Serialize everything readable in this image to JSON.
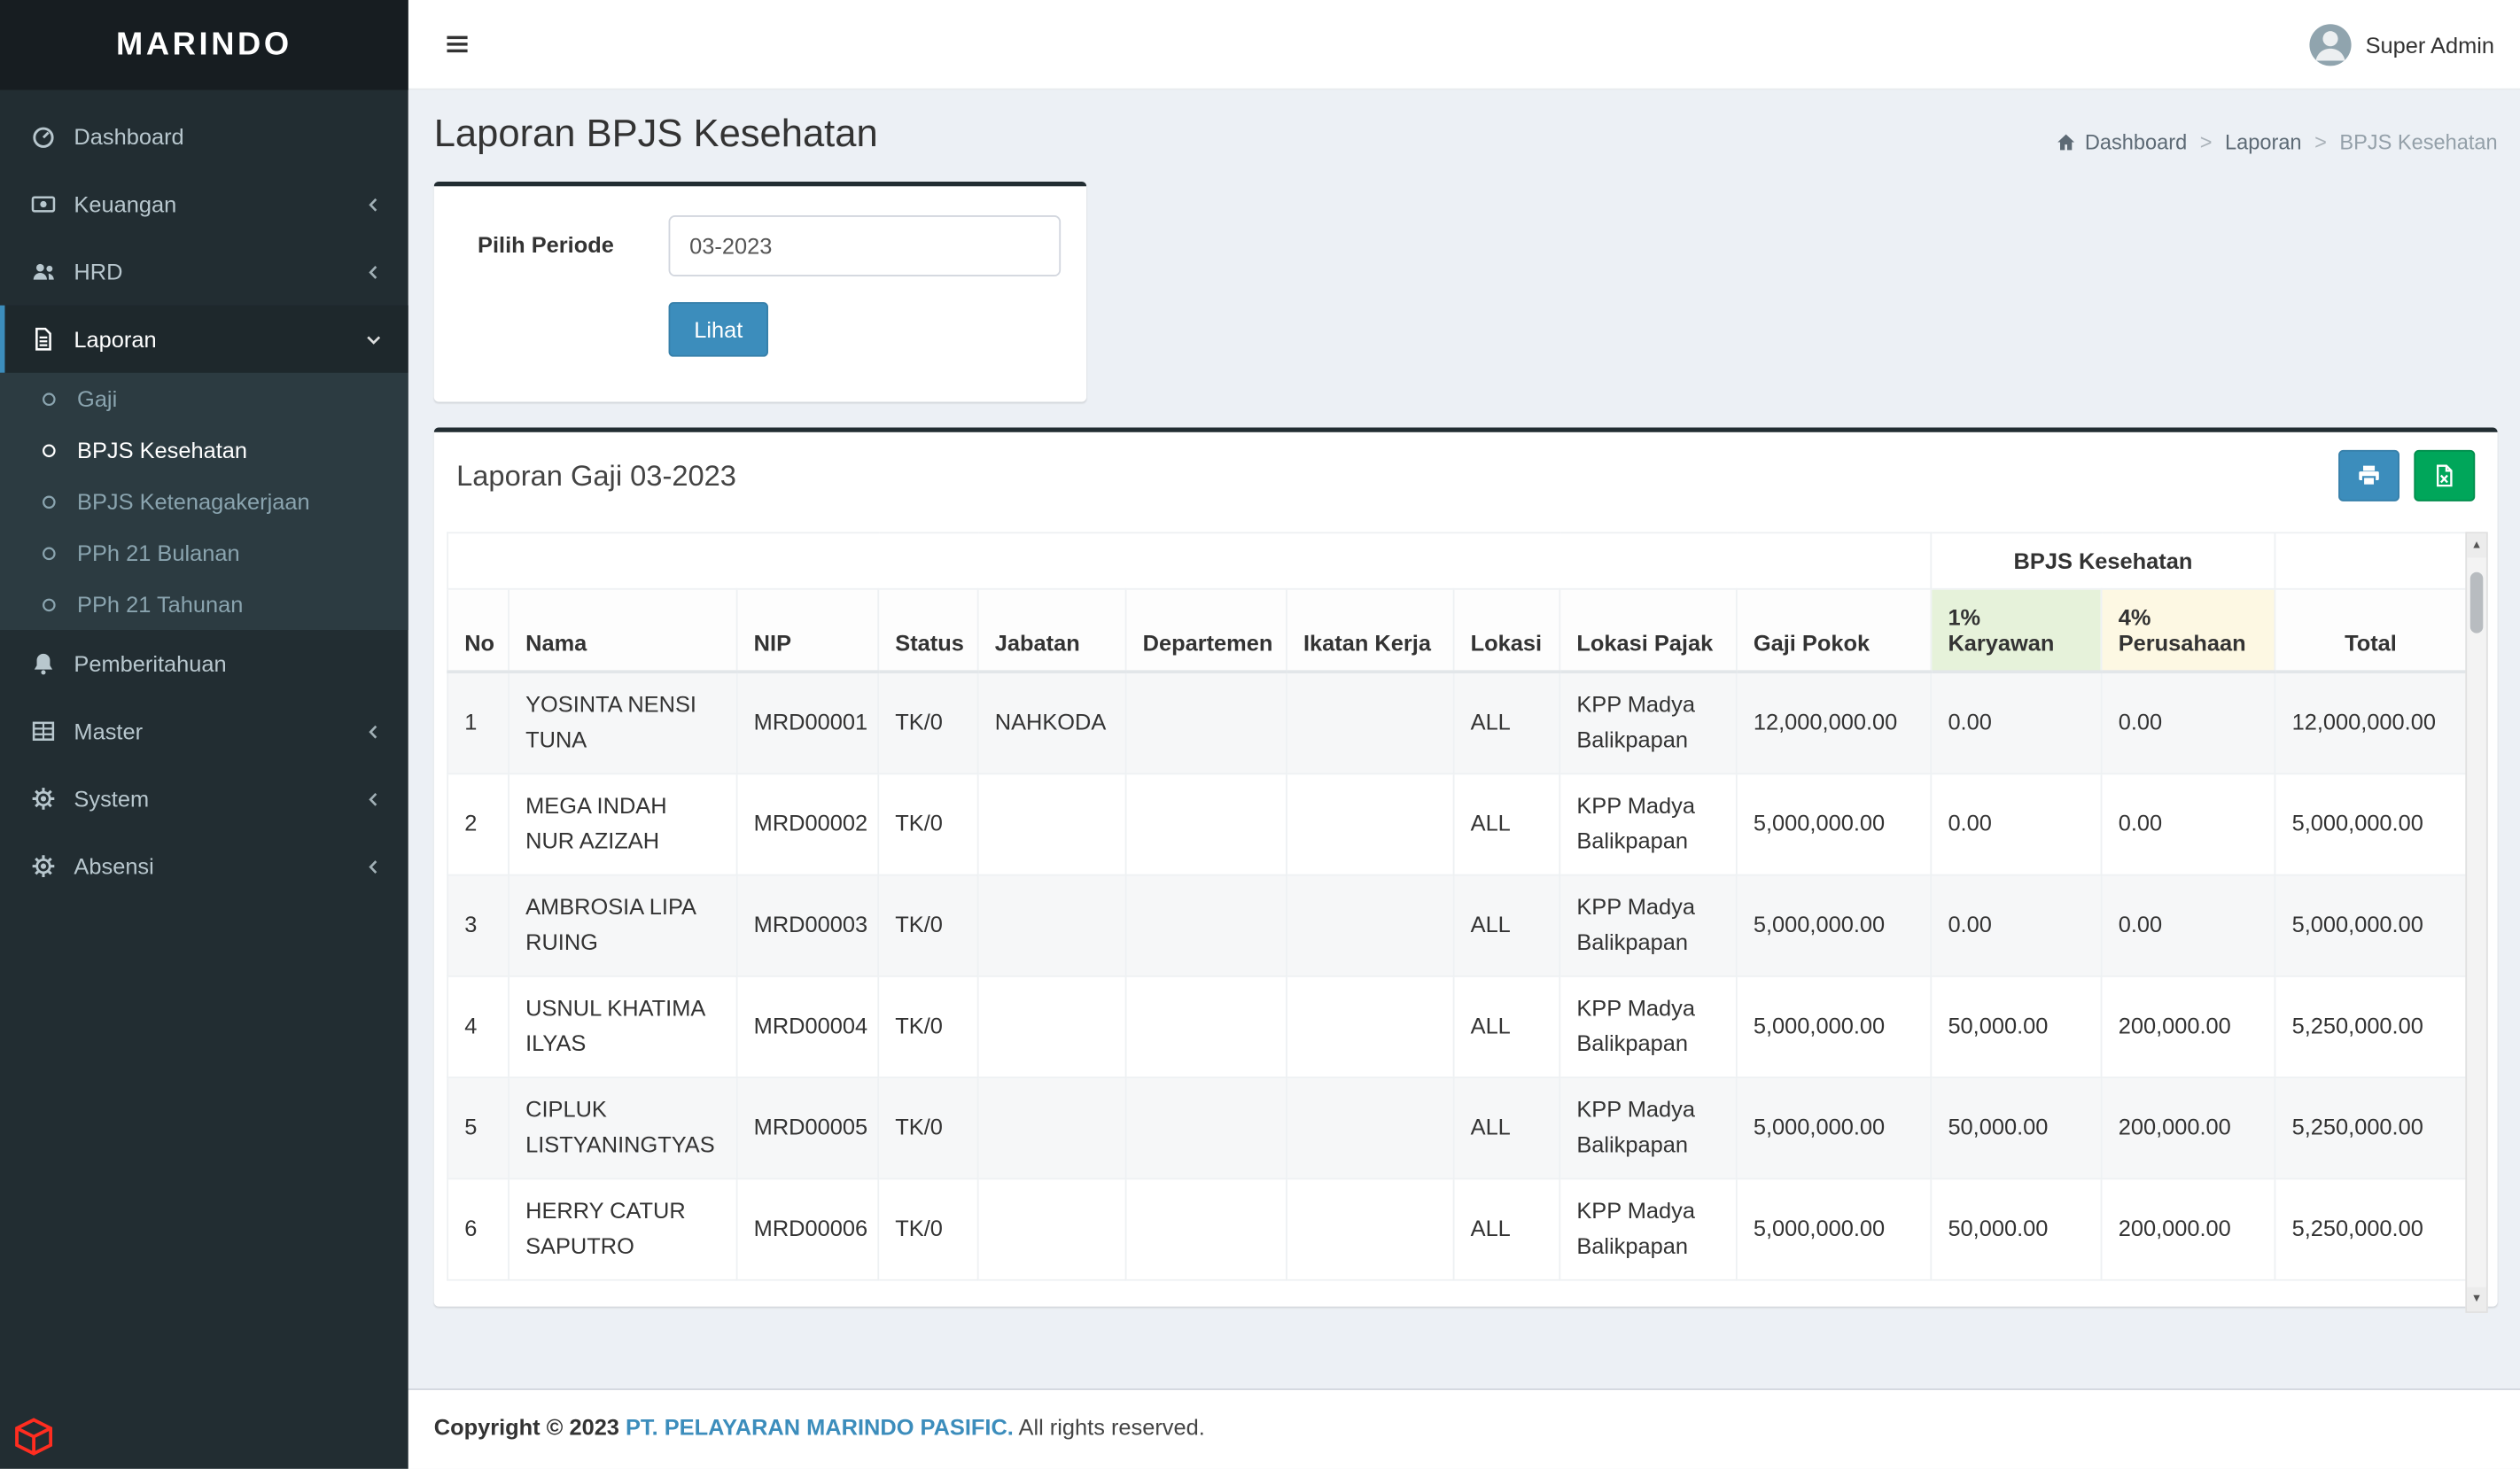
{
  "brand": "MARINDO",
  "topbar": {
    "user_name": "Super Admin"
  },
  "sidebar": {
    "items": [
      {
        "label": "Dashboard",
        "icon": "tachometer-icon"
      },
      {
        "label": "Keuangan",
        "icon": "money-icon",
        "chevron": "left"
      },
      {
        "label": "HRD",
        "icon": "users-icon",
        "chevron": "left"
      },
      {
        "label": "Laporan",
        "icon": "file-text-icon",
        "chevron": "down",
        "active": true
      },
      {
        "label": "Pemberitahuan",
        "icon": "bell-icon"
      },
      {
        "label": "Master",
        "icon": "table-icon",
        "chevron": "left"
      },
      {
        "label": "System",
        "icon": "gear-icon",
        "chevron": "left"
      },
      {
        "label": "Absensi",
        "icon": "gear-icon",
        "chevron": "left"
      }
    ],
    "laporan_children": [
      {
        "label": "Gaji",
        "icon": "circle-o-icon"
      },
      {
        "label": "BPJS Kesehatan",
        "icon": "circle-o-icon",
        "active": true
      },
      {
        "label": "BPJS Ketenagakerjaan",
        "icon": "circle-o-icon"
      },
      {
        "label": "PPh 21 Bulanan",
        "icon": "circle-o-icon"
      },
      {
        "label": "PPh 21 Tahunan",
        "icon": "circle-o-icon"
      }
    ]
  },
  "page": {
    "title": "Laporan BPJS Kesehatan",
    "breadcrumb": {
      "home": "Dashboard",
      "section": "Laporan",
      "current": "BPJS Kesehatan"
    }
  },
  "filter_box": {
    "label": "Pilih Periode",
    "period_value": "03-2023",
    "submit_label": "Lihat"
  },
  "report_box": {
    "title": "Laporan Gaji 03-2023",
    "group_header": "BPJS Kesehatan",
    "columns": [
      "No",
      "Nama",
      "NIP",
      "Status",
      "Jabatan",
      "Departemen",
      "Ikatan Kerja",
      "Lokasi",
      "Lokasi Pajak",
      "Gaji Pokok",
      "1% Karyawan",
      "4% Perusahaan",
      "Total"
    ]
  },
  "table": {
    "rows": [
      {
        "no": "1",
        "nama": "YOSINTA NENSI TUNA",
        "nip": "MRD00001",
        "status": "TK/0",
        "jabatan": "NAHKODA",
        "departemen": "",
        "ikatan_kerja": "",
        "lokasi": "ALL",
        "lokasi_pajak": "KPP Madya Balikpapan",
        "gaji_pokok": "12,000,000.00",
        "karyawan_1": "0.00",
        "perusahaan_4": "0.00",
        "total": "12,000,000.00"
      },
      {
        "no": "2",
        "nama": "MEGA INDAH NUR AZIZAH",
        "nip": "MRD00002",
        "status": "TK/0",
        "jabatan": "",
        "departemen": "",
        "ikatan_kerja": "",
        "lokasi": "ALL",
        "lokasi_pajak": "KPP Madya Balikpapan",
        "gaji_pokok": "5,000,000.00",
        "karyawan_1": "0.00",
        "perusahaan_4": "0.00",
        "total": "5,000,000.00"
      },
      {
        "no": "3",
        "nama": "AMBROSIA LIPA RUING",
        "nip": "MRD00003",
        "status": "TK/0",
        "jabatan": "",
        "departemen": "",
        "ikatan_kerja": "",
        "lokasi": "ALL",
        "lokasi_pajak": "KPP Madya Balikpapan",
        "gaji_pokok": "5,000,000.00",
        "karyawan_1": "0.00",
        "perusahaan_4": "0.00",
        "total": "5,000,000.00"
      },
      {
        "no": "4",
        "nama": "USNUL KHATIMA ILYAS",
        "nip": "MRD00004",
        "status": "TK/0",
        "jabatan": "",
        "departemen": "",
        "ikatan_kerja": "",
        "lokasi": "ALL",
        "lokasi_pajak": "KPP Madya Balikpapan",
        "gaji_pokok": "5,000,000.00",
        "karyawan_1": "50,000.00",
        "perusahaan_4": "200,000.00",
        "total": "5,250,000.00"
      },
      {
        "no": "5",
        "nama": "CIPLUK LISTYANINGTYAS",
        "nip": "MRD00005",
        "status": "TK/0",
        "jabatan": "",
        "departemen": "",
        "ikatan_kerja": "",
        "lokasi": "ALL",
        "lokasi_pajak": "KPP Madya Balikpapan",
        "gaji_pokok": "5,000,000.00",
        "karyawan_1": "50,000.00",
        "perusahaan_4": "200,000.00",
        "total": "5,250,000.00"
      },
      {
        "no": "6",
        "nama": "HERRY CATUR SAPUTRO",
        "nip": "MRD00006",
        "status": "TK/0",
        "jabatan": "",
        "departemen": "",
        "ikatan_kerja": "",
        "lokasi": "ALL",
        "lokasi_pajak": "KPP Madya Balikpapan",
        "gaji_pokok": "5,000,000.00",
        "karyawan_1": "50,000.00",
        "perusahaan_4": "200,000.00",
        "total": "5,250,000.00"
      }
    ]
  },
  "footer": {
    "copyright_prefix": "Copyright © 2023",
    "company": "PT. PELAYARAN MARINDO PASIFIC.",
    "rights": "All rights reserved."
  },
  "colors": {
    "primary": "#3c8dbc",
    "success": "#00a65a",
    "sidebar_bg": "#222d32",
    "header_green": "#e6f2da",
    "header_yellow": "#fdf8e3"
  }
}
